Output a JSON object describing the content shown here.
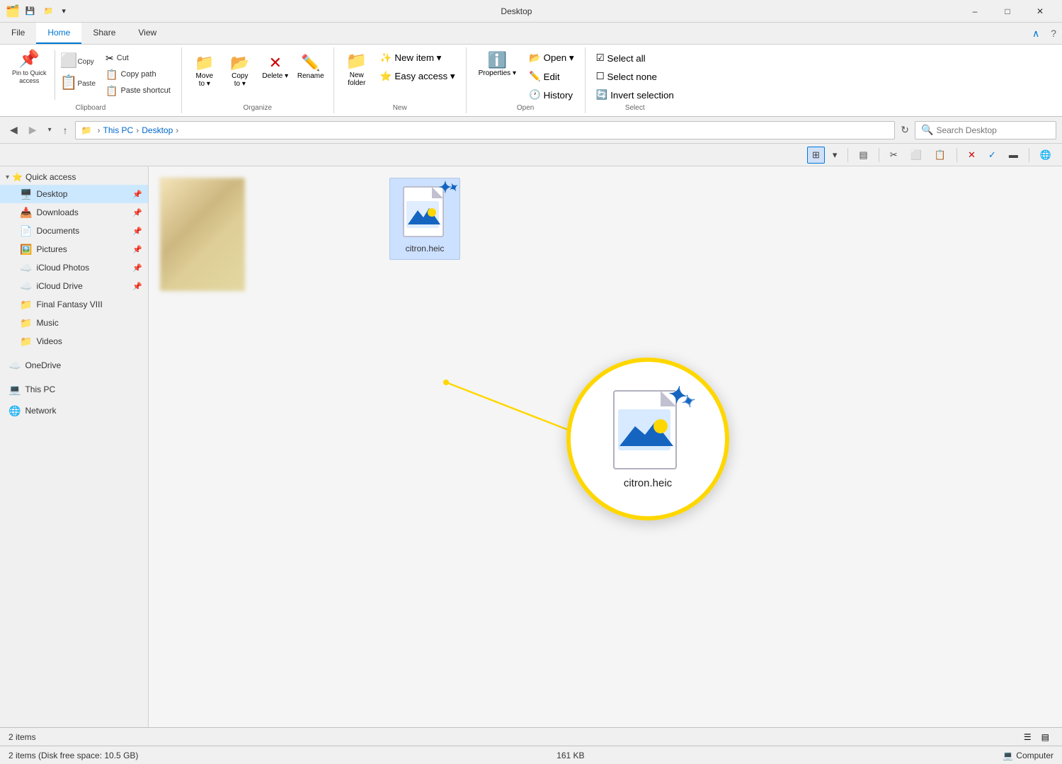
{
  "titleBar": {
    "title": "Desktop",
    "icon": "🗂️",
    "minimizeLabel": "–",
    "maximizeLabel": "□",
    "closeLabel": "✕"
  },
  "ribbon": {
    "tabs": [
      "File",
      "Home",
      "Share",
      "View"
    ],
    "activeTab": "Home",
    "groups": {
      "clipboard": {
        "label": "Clipboard",
        "pinToQuick": "Pin to Quick\naccess",
        "copy": "Copy",
        "paste": "Paste",
        "cut": "Cut",
        "copyPath": "Copy path",
        "pasteShortcut": "Paste shortcut"
      },
      "organize": {
        "label": "Organize",
        "moveTo": "Move\nto",
        "copyTo": "Copy\nto",
        "delete": "Delete",
        "rename": "Rename"
      },
      "new": {
        "label": "New",
        "newFolder": "New\nfolder",
        "newItem": "New item",
        "easyAccess": "Easy access"
      },
      "open": {
        "label": "Open",
        "open": "Open",
        "edit": "Edit",
        "history": "History",
        "properties": "Properties"
      },
      "select": {
        "label": "Select",
        "selectAll": "Select all",
        "selectNone": "Select none",
        "invertSelection": "Invert selection"
      }
    }
  },
  "addressBar": {
    "backDisabled": false,
    "forwardDisabled": false,
    "upDisabled": false,
    "breadcrumbs": [
      "This PC",
      "Desktop"
    ],
    "searchPlaceholder": "Search Desktop",
    "searchValue": ""
  },
  "sidebar": {
    "quickAccess": {
      "label": "Quick access",
      "items": [
        {
          "name": "Desktop",
          "icon": "🖥️",
          "pinned": true,
          "active": true
        },
        {
          "name": "Downloads",
          "icon": "📥",
          "pinned": true
        },
        {
          "name": "Documents",
          "icon": "📄",
          "pinned": true
        },
        {
          "name": "Pictures",
          "icon": "🖼️",
          "pinned": true
        },
        {
          "name": "iCloud Photos",
          "icon": "☁️",
          "pinned": true
        },
        {
          "name": "iCloud Drive",
          "icon": "☁️",
          "pinned": true
        },
        {
          "name": "Final Fantasy VIII",
          "icon": "📁",
          "pinned": false
        },
        {
          "name": "Music",
          "icon": "🎵",
          "pinned": false
        },
        {
          "name": "Videos",
          "icon": "📹",
          "pinned": false
        }
      ]
    },
    "oneDrive": {
      "label": "OneDrive",
      "icon": "☁️"
    },
    "thisPC": {
      "label": "This PC",
      "icon": "💻"
    },
    "network": {
      "label": "Network",
      "icon": "🌐"
    }
  },
  "fileArea": {
    "items": [
      {
        "name": "citron.heic",
        "type": "heic",
        "selected": true
      }
    ],
    "blurredThumbnail": true
  },
  "zoomOverlay": {
    "fileName": "citron.heic",
    "visible": true
  },
  "statusBar": {
    "itemCount": "2 items",
    "diskInfo": "2 items (Disk free space: 10.5 GB)",
    "fileSize": "161 KB",
    "computerLabel": "Computer"
  },
  "viewToolbar": {
    "buttons": [
      {
        "id": "large-icons",
        "icon": "⊞",
        "active": true
      },
      {
        "id": "view-options",
        "icon": "▾",
        "active": false
      },
      {
        "id": "preview-pane",
        "icon": "▤",
        "active": false
      },
      {
        "id": "cut",
        "icon": "✂",
        "active": false
      },
      {
        "id": "copy",
        "icon": "⬜",
        "active": false
      },
      {
        "id": "paste",
        "icon": "📋",
        "active": false
      },
      {
        "id": "delete",
        "icon": "✕",
        "active": false
      },
      {
        "id": "check",
        "icon": "✓",
        "active": false
      },
      {
        "id": "rename",
        "icon": "▬",
        "active": false
      },
      {
        "id": "globe",
        "icon": "🌐",
        "active": false
      }
    ]
  }
}
